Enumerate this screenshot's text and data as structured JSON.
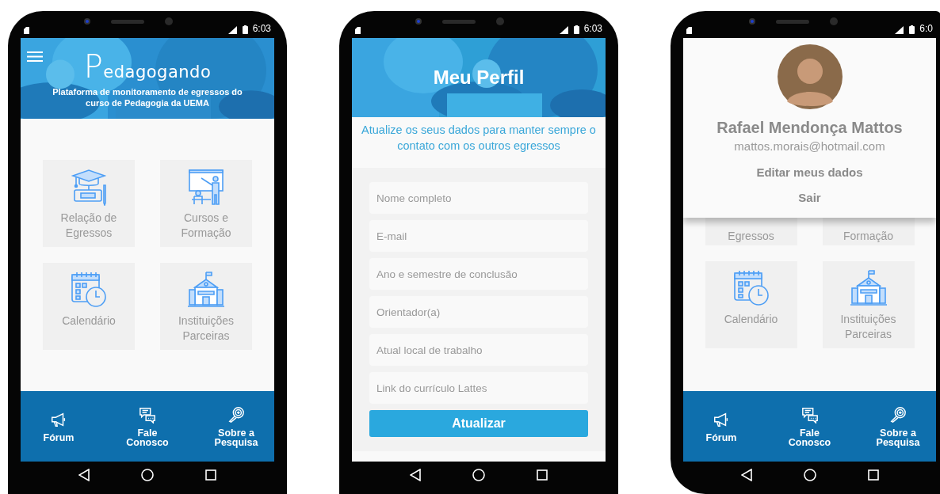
{
  "phones": [
    {
      "kind": "home",
      "status_bar": {
        "time": "6:03"
      },
      "header": {
        "logo": "Pedagogando",
        "subtitle": "Plataforma de monitoramento de egressos do curso de Pedagogia da UEMA"
      },
      "tiles": [
        {
          "label": "Relação de Egressos",
          "kind": "graduation"
        },
        {
          "label": "Cursos e Formação",
          "kind": "teacher"
        },
        {
          "label": "Calendário",
          "kind": "calendar"
        },
        {
          "label": "Instituições Parceiras",
          "kind": "school"
        }
      ],
      "nav": [
        {
          "label": "Fórum",
          "kind": "megaphone"
        },
        {
          "label": "Fale Conosco",
          "kind": "chat"
        },
        {
          "label": "Sobre a Pesquisa",
          "kind": "search"
        }
      ]
    },
    {
      "kind": "profile",
      "status_bar": {
        "time": "6:03"
      },
      "header": {
        "title": "Meu Perfil"
      },
      "intro": "Atualize os seus dados para manter sempre o contato com os outros egressos",
      "fields": [
        {
          "placeholder": "Nome completo"
        },
        {
          "placeholder": "E-mail"
        },
        {
          "placeholder": "Ano e semestre de conclusão"
        },
        {
          "placeholder": "Orientador(a)"
        },
        {
          "placeholder": "Atual local de trabalho"
        },
        {
          "placeholder": "Link do currículo Lattes"
        }
      ],
      "button": "Atualizar"
    },
    {
      "kind": "drawer",
      "status_bar": {
        "time": "6:0"
      },
      "drawer": {
        "name": "Rafael Mendonça Mattos",
        "email": "mattos.morais@hotmail.com",
        "links": [
          "Editar meus dados",
          "Sair"
        ]
      },
      "tiles": [
        {
          "label": "Egressos",
          "kind": "partial"
        },
        {
          "label": "Formação",
          "kind": "partial"
        },
        {
          "label": "Calendário",
          "kind": "calendar"
        },
        {
          "label": "Instituições Parceiras",
          "kind": "school"
        }
      ],
      "nav": [
        {
          "label": "Fórum",
          "kind": "megaphone"
        },
        {
          "label": "Fale Conosco",
          "kind": "chat"
        },
        {
          "label": "Sobre a Pesquisa",
          "kind": "search"
        }
      ]
    }
  ]
}
